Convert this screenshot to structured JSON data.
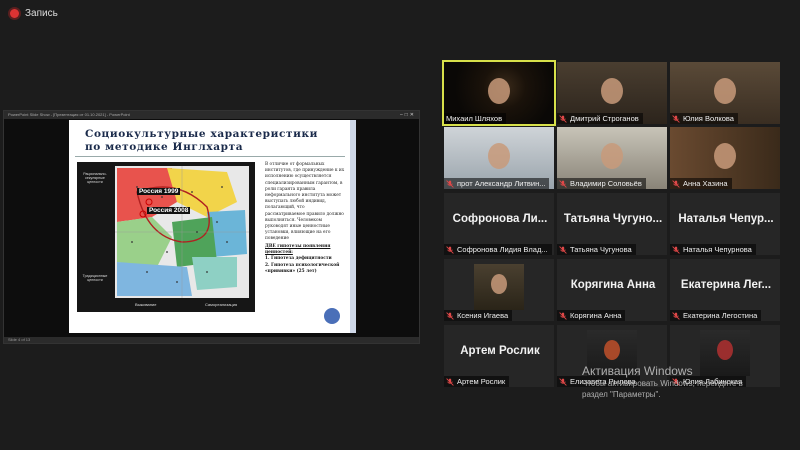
{
  "recording": {
    "label": "Запись",
    "color": "#d33333"
  },
  "shared_window": {
    "titlebar": "PowerPoint Slide Show - [Презентация от 01.10.2021] - PowerPoint",
    "status": "Slide 4 of 13",
    "slide": {
      "title_line1": "Социокультурные характеристики",
      "title_line2": "по методике Инглхарта",
      "map_labels": {
        "russia_1999": "Россия 1999",
        "russia_2008": "Россия 2008",
        "y_top": "Рационально-секулярные ценности",
        "y_bottom": "Традиционные ценности",
        "x_left": "Выживание",
        "x_right": "Самореализация"
      },
      "body_text": "В отличие от формальных институтов, где принуждение к их исполнению осуществляется специализированным гарантом, в роли гаранта правила неформального института может выступать любой индивид, полагающий, что рассматриваемое правило должно выполняться. Человеком руководят иные ценностные установки, влияющие на его поведение",
      "hyp_title": "ДВЕ гипотезы появления ценностей:",
      "hyp_1": "Гипотеза дефицитности",
      "hyp_2": "Гипотеза психологической «прививки» (25 лет)"
    }
  },
  "participants": [
    {
      "name": "Михаил Шляхов",
      "muted": false,
      "video": true,
      "active": true
    },
    {
      "name": "Дмитрий Строганов",
      "muted": true,
      "video": true
    },
    {
      "name": "Юлия Волкова",
      "muted": true,
      "video": true
    },
    {
      "name": "прот Александр Литвин...",
      "muted": true,
      "video": true
    },
    {
      "name": "Владимир Соловьёв",
      "muted": true,
      "video": true
    },
    {
      "name": "Анна Хазина",
      "muted": true,
      "video": true
    },
    {
      "name": "Софронова Лидия Влад...",
      "big": "Софронова Ли...",
      "muted": true,
      "video": false
    },
    {
      "name": "Татьяна Чугунова",
      "big": "Татьяна Чугуно...",
      "muted": true,
      "video": false
    },
    {
      "name": "Наталья Чепурнова",
      "big": "Наталья Чепур...",
      "muted": true,
      "video": false
    },
    {
      "name": "Ксения Игаева",
      "muted": true,
      "video": true
    },
    {
      "name": "Корягина Анна",
      "big": "Корягина Анна",
      "muted": true,
      "video": false
    },
    {
      "name": "Екатерина Легостина",
      "big": "Екатерина Лег...",
      "muted": true,
      "video": false
    },
    {
      "name": "Артем Рослик",
      "big": "Артем Рослик",
      "muted": true,
      "video": false
    },
    {
      "name": "Елизавета Рылова",
      "muted": true,
      "video": true
    },
    {
      "name": "Юлия Лабинская",
      "muted": true,
      "video": true
    }
  ],
  "watermark": {
    "title": "Активация Windows",
    "line1": "Чтобы активировать Windows, перейдите в",
    "line2": "раздел \"Параметры\"."
  }
}
